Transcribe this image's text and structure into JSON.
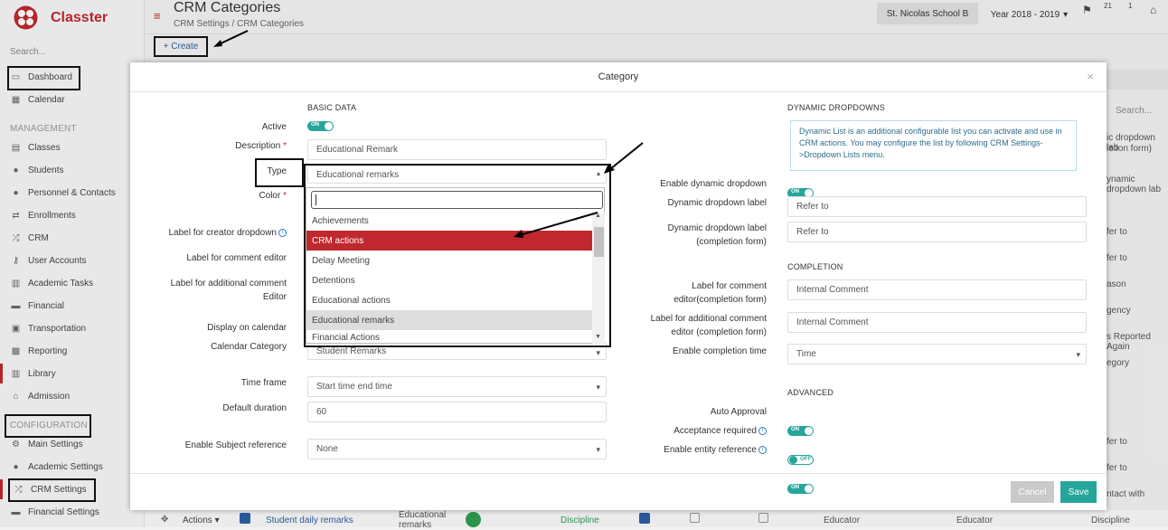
{
  "sidebar": {
    "brand": "Classter",
    "search": "Search...",
    "dashboard": "Dashboard",
    "calendar": "Calendar",
    "management_title": "MANAGEMENT",
    "management": [
      "Classes",
      "Students",
      "Personnel & Contacts",
      "Enrollments",
      "CRM",
      "User Accounts",
      "Academic Tasks",
      "Financial",
      "Transportation",
      "Reporting",
      "Library",
      "Admission"
    ],
    "configuration_title": "CONFIGURATION",
    "configuration": [
      "Main Settings",
      "Academic Settings",
      "CRM Settings",
      "Financial Settings"
    ]
  },
  "header": {
    "title": "CRM Categories",
    "breadcrumb": "CRM Settings  /  CRM Categories",
    "school": "St. Nicolas School B",
    "year": "Year 2018 - 2019",
    "badge1": "21",
    "badge2": "1",
    "create": "+ Create"
  },
  "background": {
    "search": "Search...",
    "right_col": [
      "ic dropdown lab",
      "letion form)",
      "ynamic dropdown lab",
      "fer to",
      "fer to",
      "ason",
      "gency",
      "s Reported Again",
      "egory",
      "fer to",
      "fer to",
      "ntact with"
    ],
    "bottom_row": {
      "actions": "Actions",
      "name": "Student daily remarks",
      "desc": "Educational remarks",
      "type": "Discipline",
      "c1": "Educator",
      "c2": "Educator",
      "c3": "Discipline"
    }
  },
  "modal": {
    "title": "Category",
    "basic_title": "BASIC DATA",
    "active_label": "Active",
    "description_label": "Description",
    "description_value": "Educational Remark",
    "type_label": "Type",
    "type_value": "Educational remarks",
    "color_label": "Color",
    "creator_dropdown_label": "Label for creator dropdown",
    "comment_editor_label": "Label for comment editor",
    "additional_comment_label": "Label for additional comment Editor",
    "display_calendar_label": "Display on calendar",
    "calendar_category_label": "Calendar Category",
    "calendar_category_value": "Student Remarks",
    "time_frame_label": "Time frame",
    "time_frame_value": "Start time end time",
    "default_duration_label": "Default duration",
    "default_duration_value": "60",
    "subject_reference_label": "Enable Subject reference",
    "subject_reference_value": "None",
    "dropdown_options": [
      "Achievements",
      "CRM actions",
      "Delay Meeting",
      "Detentions",
      "Educational actions",
      "Educational remarks",
      "Financial Actions"
    ],
    "highlighted_option": "CRM actions",
    "selected_option": "Educational remarks",
    "dyn_title": "DYNAMIC DROPDOWNS",
    "dyn_info": "Dynamic List is an additional configurable list you can activate and use in CRM actions. You may configure the list by following CRM Settings->Dropdown Lists menu.",
    "enable_dyn_label": "Enable dynamic dropdown",
    "dyn_label_label": "Dynamic dropdown label",
    "dyn_label_value": "Refer to",
    "dyn_label_completion_label": "Dynamic dropdown label (completion form)",
    "dyn_label_completion_value": "Refer to",
    "completion_title": "COMPLETION",
    "comment_completion_label": "Label for comment editor(completion form)",
    "comment_completion_value": "Internal Comment",
    "add_comment_completion_label": "Label for additional comment editor (completion form)",
    "add_comment_completion_value": "Internal Comment",
    "completion_time_label": "Enable completion time",
    "completion_time_value": "Time",
    "advanced_title": "ADVANCED",
    "auto_approval_label": "Auto Approval",
    "acceptance_label": "Acceptance required",
    "entity_ref_label": "Enable entity reference",
    "on": "ON",
    "off": "OFF",
    "cancel": "Cancel",
    "save": "Save"
  }
}
